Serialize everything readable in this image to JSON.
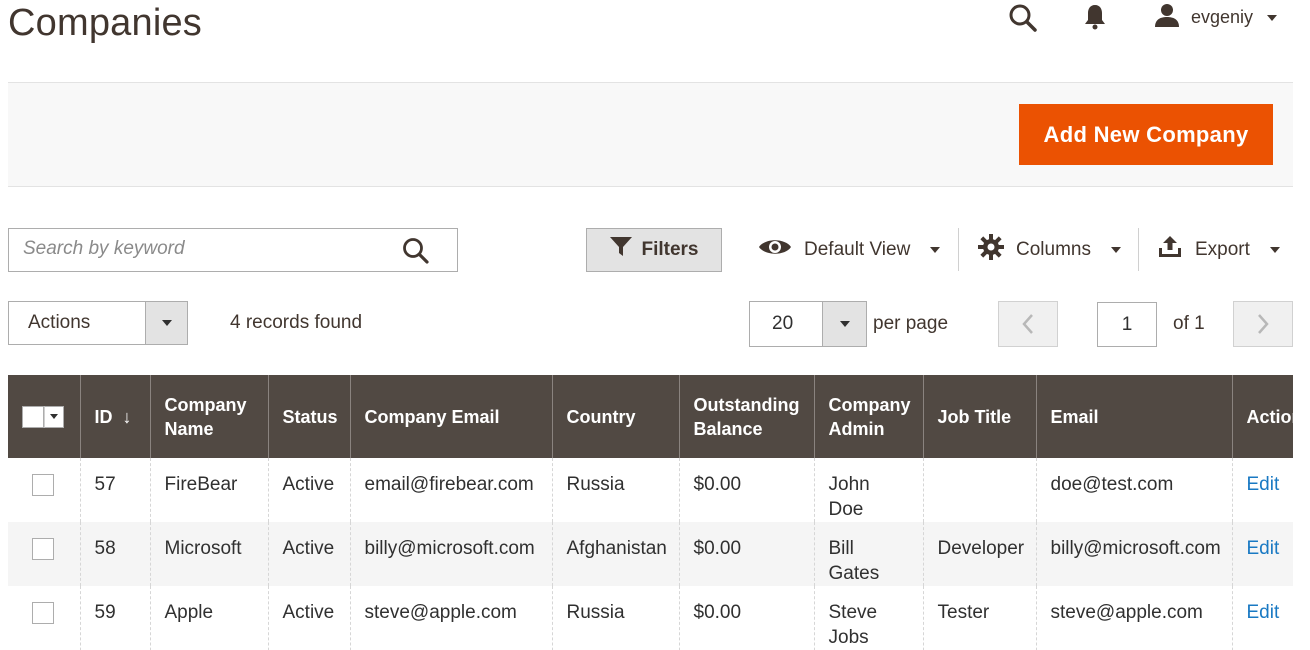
{
  "page": {
    "title": "Companies"
  },
  "header": {
    "username": "evgeniy",
    "search_icon": "search-icon",
    "bell_icon": "bell-icon",
    "user_icon": "user-icon"
  },
  "action_bar": {
    "add_button_label": "Add New Company",
    "accent_color": "#eb5202"
  },
  "toolbar": {
    "search_placeholder": "Search by keyword",
    "filters_label": "Filters",
    "view_label": "Default View",
    "columns_label": "Columns",
    "export_label": "Export"
  },
  "listing": {
    "actions_label": "Actions",
    "records_found": "4 records found",
    "per_page_value": "20",
    "per_page_label": "per page",
    "current_page": "1",
    "total_pages_label": "of 1"
  },
  "grid": {
    "columns": [
      "ID",
      "Company Name",
      "Status",
      "Company Email",
      "Country",
      "Outstanding Balance",
      "Company Admin",
      "Job Title",
      "Email",
      "Action"
    ],
    "rows": [
      {
        "id": "57",
        "company_name": "FireBear",
        "status": "Active",
        "company_email": "email@firebear.com",
        "country": "Russia",
        "balance": "$0.00",
        "admin": "John Doe",
        "job_title": "",
        "email": "doe@test.com",
        "action": "Edit"
      },
      {
        "id": "58",
        "company_name": "Microsoft",
        "status": "Active",
        "company_email": "billy@microsoft.com",
        "country": "Afghanistan",
        "balance": "$0.00",
        "admin": "Bill Gates",
        "job_title": "Developer",
        "email": "billy@microsoft.com",
        "action": "Edit"
      },
      {
        "id": "59",
        "company_name": "Apple",
        "status": "Active",
        "company_email": "steve@apple.com",
        "country": "Russia",
        "balance": "$0.00",
        "admin": "Steve Jobs",
        "job_title": "Tester",
        "email": "steve@apple.com",
        "action": "Edit"
      }
    ],
    "header_color": "#514943",
    "link_color": "#1979c3"
  }
}
